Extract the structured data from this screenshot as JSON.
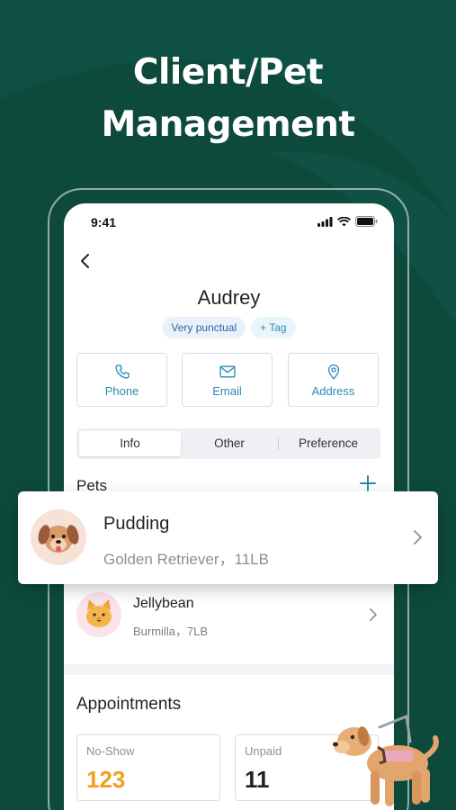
{
  "promo": {
    "headline_line1": "Client/Pet",
    "headline_line2": "Management"
  },
  "status_bar": {
    "time": "9:41"
  },
  "client": {
    "name": "Audrey",
    "tags": [
      "Very punctual"
    ],
    "add_tag_label": "+ Tag"
  },
  "contact_actions": {
    "phone": "Phone",
    "email": "Email",
    "address": "Address"
  },
  "tabs": {
    "items": [
      "Info",
      "Other",
      "Preference"
    ],
    "active": "Info"
  },
  "pets": {
    "heading": "Pets",
    "items": [
      {
        "name": "Pudding",
        "details": "Golden Retriever，11LB",
        "icon": "dog-face-icon"
      },
      {
        "name": "Jellybean",
        "details": "Burmilla，7LB",
        "icon": "cat-face-icon"
      }
    ]
  },
  "appointments": {
    "heading": "Appointments",
    "stats": [
      {
        "label": "No-Show",
        "value": "123",
        "color": "#f0a020"
      },
      {
        "label": "Unpaid",
        "value": "11",
        "color": "#1f2328"
      }
    ]
  },
  "colors": {
    "background": "#0d4a3c",
    "accent": "#2a8cb5"
  }
}
